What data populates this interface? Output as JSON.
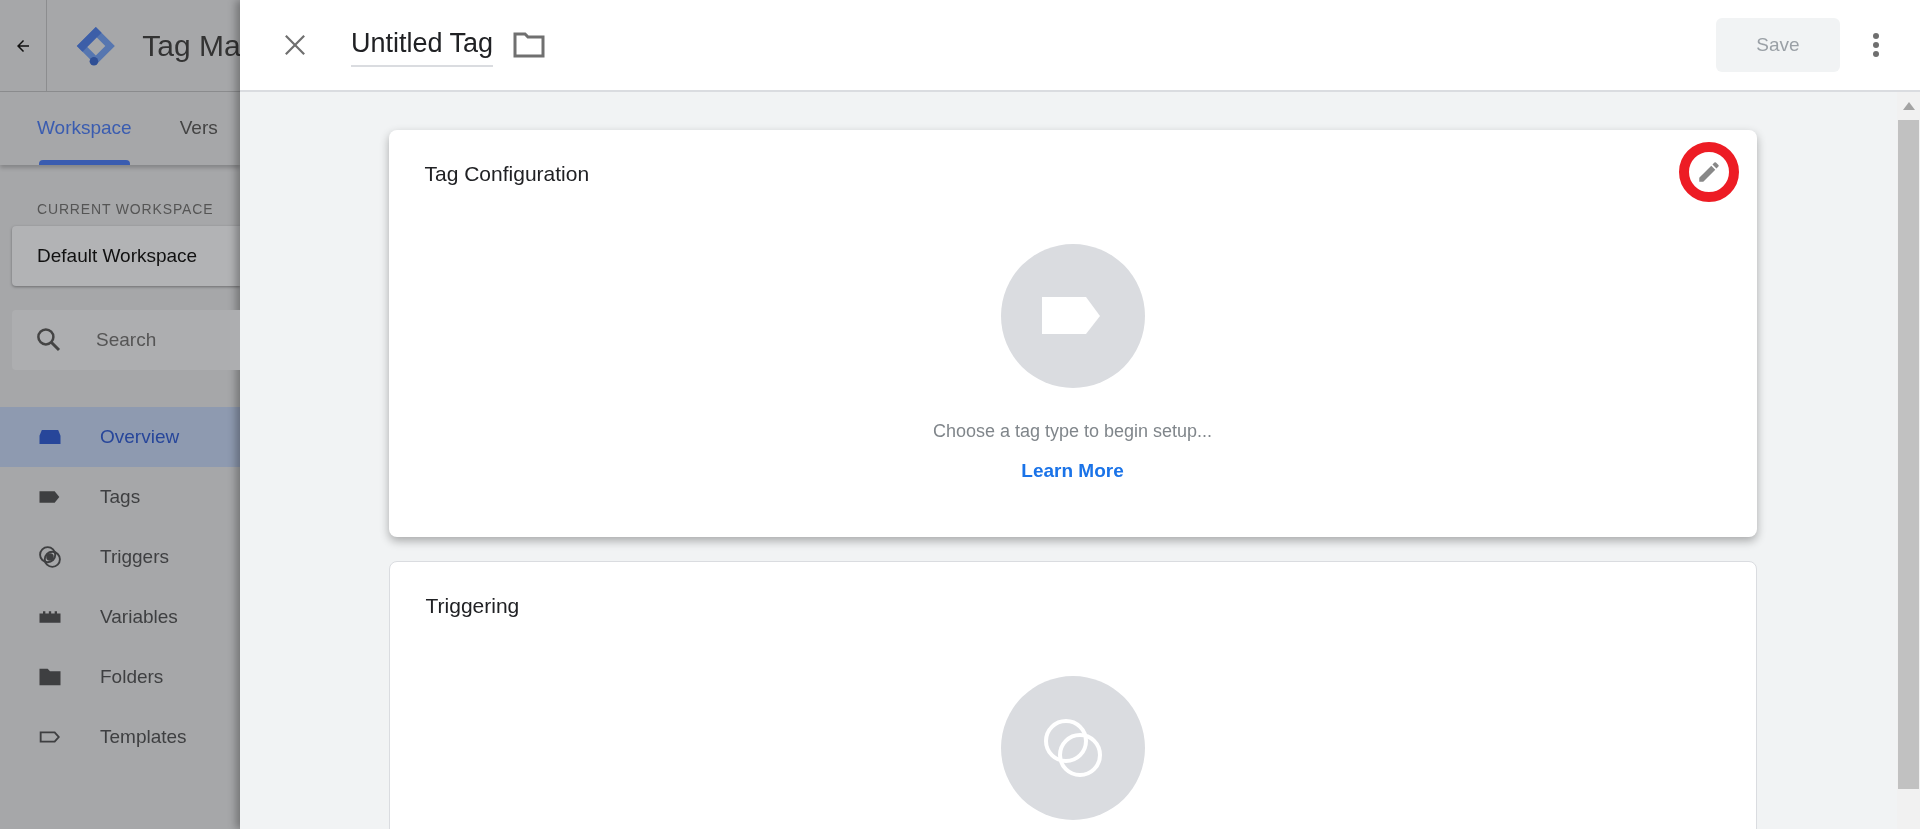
{
  "app_bar": {
    "title": "Tag Ma"
  },
  "tabs": [
    {
      "label": "Workspace",
      "selected": true
    },
    {
      "label": "Vers",
      "selected": false
    }
  ],
  "workspace": {
    "heading": "CURRENT WORKSPACE",
    "name": "Default Workspace"
  },
  "search": {
    "placeholder": "Search"
  },
  "nav": [
    {
      "label": "Overview",
      "selected": true
    },
    {
      "label": "Tags",
      "selected": false
    },
    {
      "label": "Triggers",
      "selected": false
    },
    {
      "label": "Variables",
      "selected": false
    },
    {
      "label": "Folders",
      "selected": false
    },
    {
      "label": "Templates",
      "selected": false
    }
  ],
  "panel": {
    "title": "Untitled Tag",
    "save": {
      "label": "Save",
      "disabled": true
    }
  },
  "cards": [
    {
      "kind": "tag",
      "title": "Tag Configuration",
      "hint": "Choose a tag type to begin setup...",
      "link": "Learn More",
      "highlighted": true
    },
    {
      "kind": "trigger",
      "title": "Triggering"
    }
  ]
}
